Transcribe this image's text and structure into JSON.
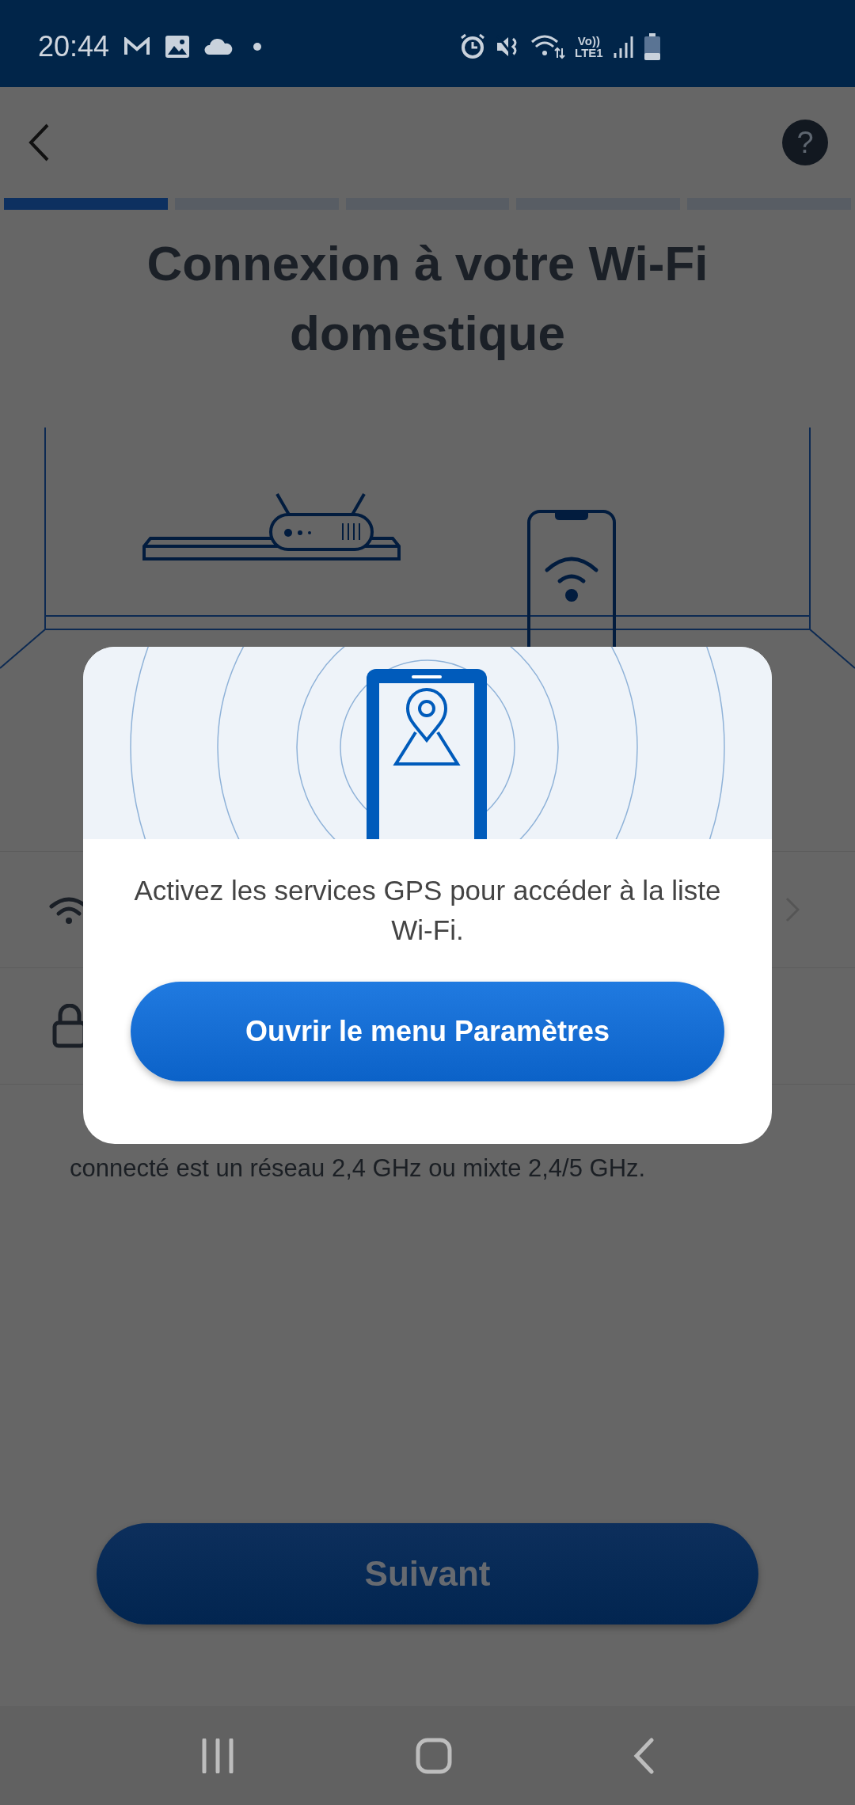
{
  "status_bar": {
    "time": "20:44",
    "volte_label": "Vo))",
    "lte_label": "LTE1"
  },
  "header": {
    "help_label": "?"
  },
  "progress": [
    {
      "completed": true
    },
    {
      "completed": false
    },
    {
      "completed": false
    },
    {
      "completed": false
    },
    {
      "completed": false
    }
  ],
  "title": "Connexion à votre Wi-Fi domestique",
  "form_rows": [
    {
      "kind": "wifi"
    },
    {
      "kind": "lock"
    }
  ],
  "note": "connecté est un réseau 2,4 GHz ou mixte 2,4/5 GHz.",
  "next_button": {
    "label": "Suivant"
  },
  "dialog": {
    "message": "Activez les services GPS pour accéder à la liste Wi-Fi.",
    "button": "Ouvrir le menu Paramètres"
  }
}
